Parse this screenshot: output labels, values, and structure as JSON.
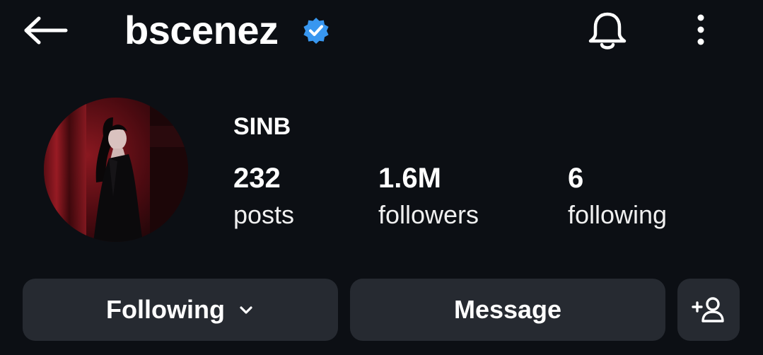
{
  "header": {
    "username": "bscenez",
    "verified_icon": "verified-badge-icon",
    "back_icon": "arrow-left-icon",
    "notifications_icon": "bell-icon",
    "more_icon": "more-vertical-icon"
  },
  "profile": {
    "display_name": "SINB",
    "stats": [
      {
        "value": "232",
        "label": "posts"
      },
      {
        "value": "1.6M",
        "label": "followers"
      },
      {
        "value": "6",
        "label": "following"
      }
    ]
  },
  "actions": {
    "following_label": "Following",
    "message_label": "Message",
    "add_person_icon": "add-person-icon"
  },
  "colors": {
    "background": "#0c0f14",
    "button_bg": "#262a31",
    "verified_blue": "#3897f0",
    "text": "#ffffff"
  }
}
